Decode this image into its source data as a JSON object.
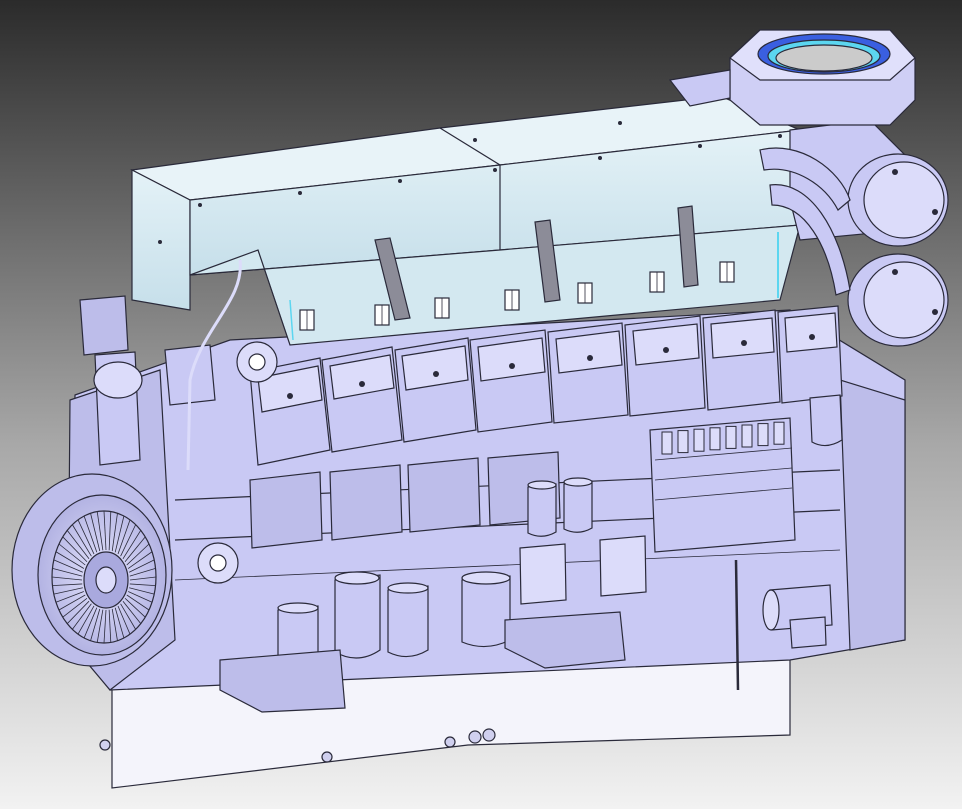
{
  "scene": {
    "subject": "engine-cad-render",
    "colors": {
      "background_top": "#2b2b2b",
      "background_bottom": "#f2f2f2",
      "body": "#c9c9f4",
      "body_light": "#dcdcfa",
      "body_dark": "#a9a9de",
      "cover_panel": "#d7ebf2",
      "cover_panel_dark": "#c3dde8",
      "strap": "#8c8c98",
      "accent_blue": "#3a5fe0",
      "accent_cyan": "#5cd6f0",
      "outline": "#2a2a3a",
      "base_white": "#f4f4fb"
    },
    "cylinder_count": 8,
    "filter_count": 6
  }
}
